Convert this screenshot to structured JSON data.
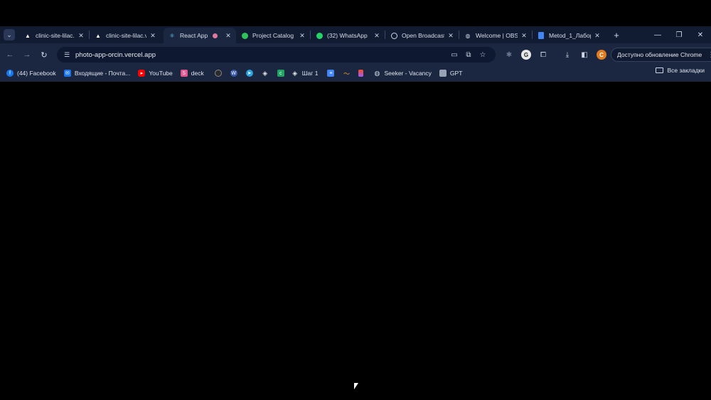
{
  "tabs": [
    {
      "title": "clinic-site-lilac.ve",
      "icon": "triangle-icon",
      "active": false
    },
    {
      "title": "clinic-site-lilac.ve",
      "icon": "triangle-icon",
      "active": false
    },
    {
      "title": "React App",
      "icon": "react-icon",
      "active": true
    },
    {
      "title": "Project Catalog",
      "icon": "green-circle-icon",
      "active": false
    },
    {
      "title": "(32) WhatsApp",
      "icon": "whatsapp-icon",
      "active": false
    },
    {
      "title": "Open Broadcast",
      "icon": "obs-icon",
      "active": false
    },
    {
      "title": "Welcome | OBS",
      "icon": "globe-icon",
      "active": false
    },
    {
      "title": "Metod_1_Лабор",
      "icon": "docs-icon",
      "active": false
    }
  ],
  "toolbar": {
    "url": "photo-app-orcin.vercel.app",
    "update_label": "Доступно обновление Chrome",
    "profile_initial": "C"
  },
  "bookmarks": [
    {
      "label": "(44) Facebook",
      "icon": "facebook-icon",
      "color": "#1877f2"
    },
    {
      "label": "Входящие - Почта...",
      "icon": "mail-icon",
      "color": "#1a73e8"
    },
    {
      "label": "YouTube",
      "icon": "youtube-icon",
      "color": "#ff0000"
    },
    {
      "label": "deck",
      "icon": "deck-icon",
      "color": "#e2568f"
    },
    {
      "label": "",
      "icon": "github-icon",
      "color": "#2b2b2b"
    },
    {
      "label": "",
      "icon": "wordpress-icon",
      "color": "#3858a8"
    },
    {
      "label": "",
      "icon": "telegram-icon",
      "color": "#2aa3e0"
    },
    {
      "label": "",
      "icon": "diamond-icon",
      "color": "#3a3a3a"
    },
    {
      "label": "",
      "icon": "green-square-icon",
      "color": "#1fa463"
    },
    {
      "label": "Шаг 1",
      "icon": "step-icon",
      "color": "#3a3a3a"
    },
    {
      "label": "",
      "icon": "docs-icon",
      "color": "#4285f4"
    },
    {
      "label": "",
      "icon": "wave-icon",
      "color": "#f0a020"
    },
    {
      "label": "",
      "icon": "figma-icon",
      "color": "#f24e1e"
    },
    {
      "label": "Seeker - Vacancy",
      "icon": "globe-icon",
      "color": "#8f98ad"
    },
    {
      "label": "GPT",
      "icon": "gpt-icon",
      "color": "#9aa3b5"
    }
  ],
  "all_bookmarks_label": "Все закладки"
}
